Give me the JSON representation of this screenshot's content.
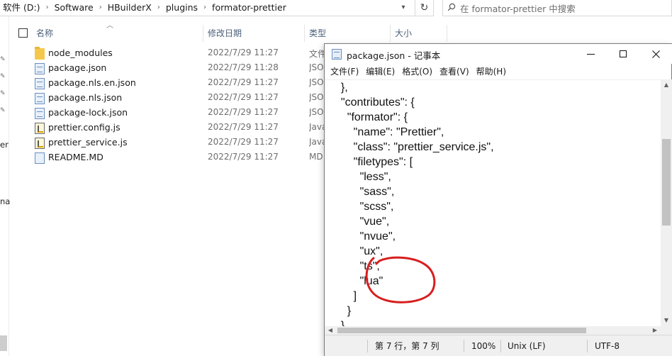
{
  "explorer": {
    "breadcrumb": [
      "软件 (D:)",
      "Software",
      "HBuilderX",
      "plugins",
      "formator-prettier"
    ],
    "search_placeholder": "在 formator-prettier 中搜索",
    "columns": {
      "name": "名称",
      "modified": "修改日期",
      "type": "类型",
      "size": "大小"
    },
    "left_strip_texts": [
      "er",
      "na"
    ],
    "files": [
      {
        "name": "node_modules",
        "date": "2022/7/29 11:27",
        "type": "文件夹",
        "icon": "folder-icon"
      },
      {
        "name": "package.json",
        "date": "2022/7/29 11:28",
        "type": "JSON",
        "icon": "json-file-icon"
      },
      {
        "name": "package.nls.en.json",
        "date": "2022/7/29 11:27",
        "type": "JSON",
        "icon": "json-file-icon"
      },
      {
        "name": "package.nls.json",
        "date": "2022/7/29 11:27",
        "type": "JSON",
        "icon": "json-file-icon"
      },
      {
        "name": "package-lock.json",
        "date": "2022/7/29 11:27",
        "type": "JSON",
        "icon": "json-file-icon"
      },
      {
        "name": "prettier.config.js",
        "date": "2022/7/29 11:27",
        "type": "JavaScript",
        "icon": "js-file-icon"
      },
      {
        "name": "prettier_service.js",
        "date": "2022/7/29 11:27",
        "type": "JavaScript",
        "icon": "js-file-icon"
      },
      {
        "name": "README.MD",
        "date": "2022/7/29 11:27",
        "type": "MD",
        "icon": "md-file-icon"
      }
    ]
  },
  "notepad": {
    "title": "package.json - 记事本",
    "menu": [
      "文件(F)",
      "编辑(E)",
      "格式(O)",
      "查看(V)",
      "帮助(H)"
    ],
    "lines": [
      "  },",
      "  \"contributes\": {",
      "    \"formator\": {",
      "      \"name\": \"Prettier\",",
      "      \"class\": \"prettier_service.js\",",
      "      \"filetypes\": [",
      "        \"less\",",
      "        \"sass\",",
      "        \"scss\",",
      "        \"vue\",",
      "        \"nvue\",",
      "        \"ux\",",
      "        \"ts\",",
      "        \"lua\"",
      "      ]",
      "    }",
      "  }"
    ],
    "status": {
      "position": "第 7 行，第 7 列",
      "zoom": "100%",
      "line_ending": "Unix (LF)",
      "encoding": "UTF-8"
    }
  },
  "colors": {
    "annotation": "#d81e1e",
    "header_text": "#4c607a",
    "folder": "#f5c84c"
  }
}
